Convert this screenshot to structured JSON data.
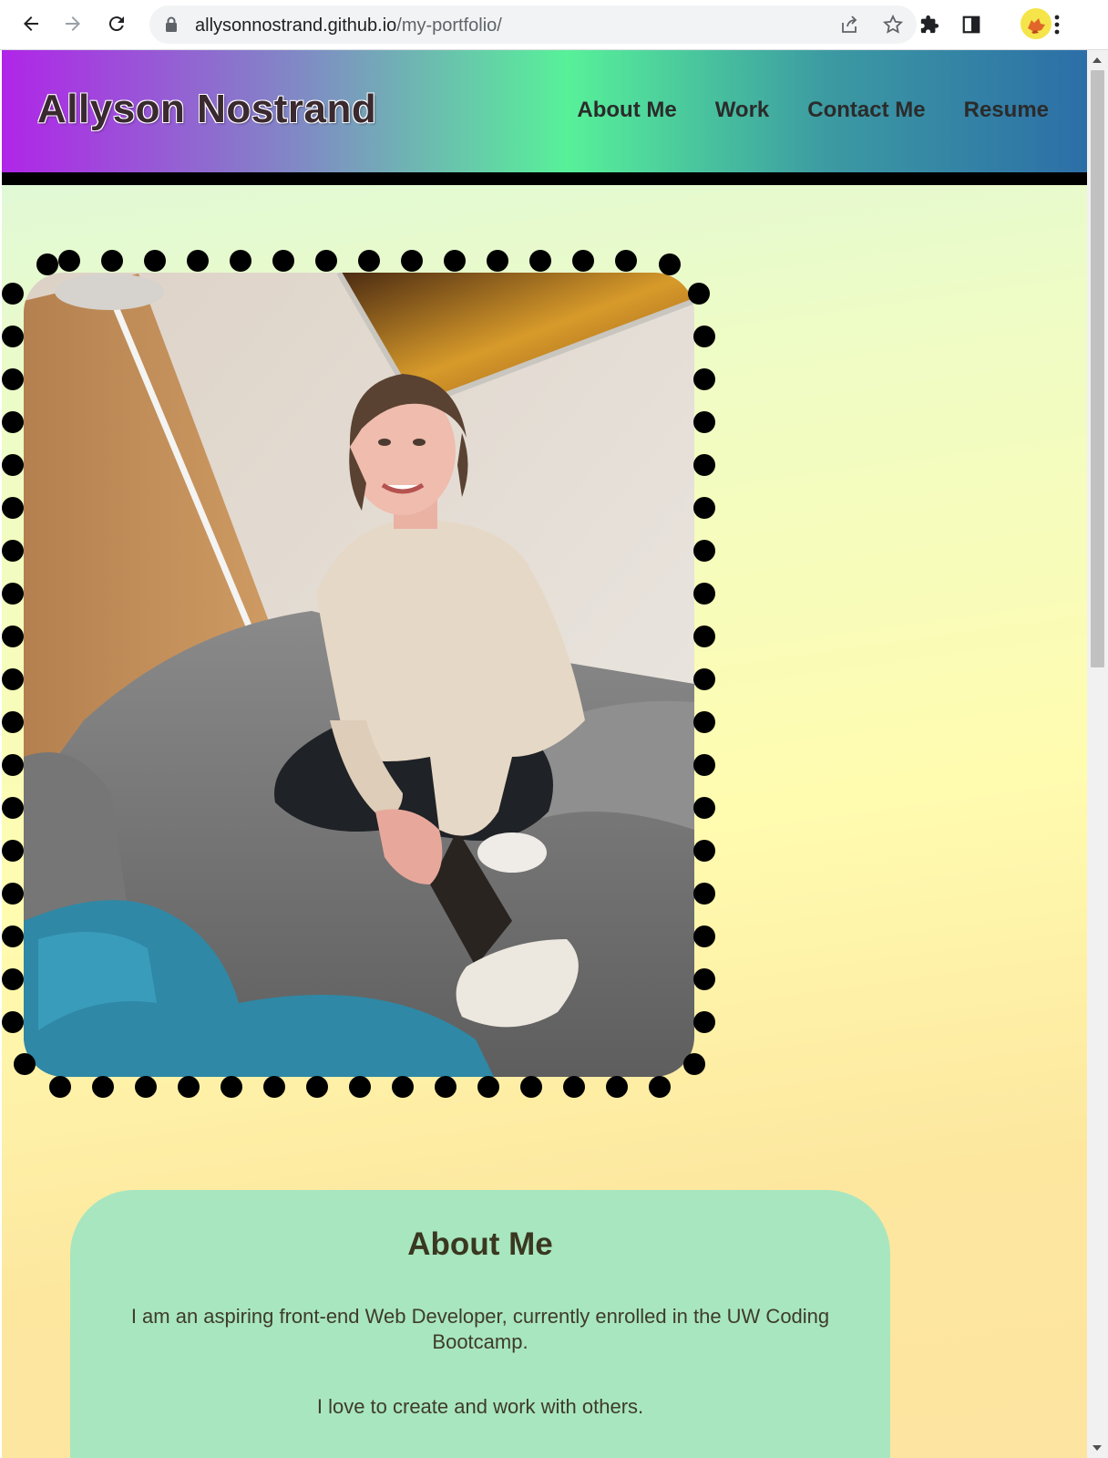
{
  "browser": {
    "url_host": "allysonnostrand.github.io",
    "url_path": "/my-portfolio/",
    "icons": [
      "back-icon",
      "forward-icon",
      "reload-icon",
      "lock-icon",
      "share-icon",
      "star-icon",
      "extensions-icon",
      "side-panel-icon",
      "profile-avatar",
      "menu-icon"
    ]
  },
  "header": {
    "title": "Allyson Nostrand",
    "nav": [
      "About Me",
      "Work",
      "Contact Me",
      "Resume"
    ]
  },
  "portrait": {
    "description_icon": "portrait-photo"
  },
  "about": {
    "heading": "About Me",
    "paragraphs": [
      "I am an aspiring front-end Web Developer, currently enrolled in the UW Coding Bootcamp.",
      "I love to create and work with others."
    ]
  },
  "colors": {
    "header_gradient": [
      "#b025e8",
      "#7f8cc4",
      "#57f199",
      "#3c9aa2",
      "#2c6ea8"
    ],
    "card_bg": "#a8e6bf",
    "dot_border": "#000000"
  }
}
